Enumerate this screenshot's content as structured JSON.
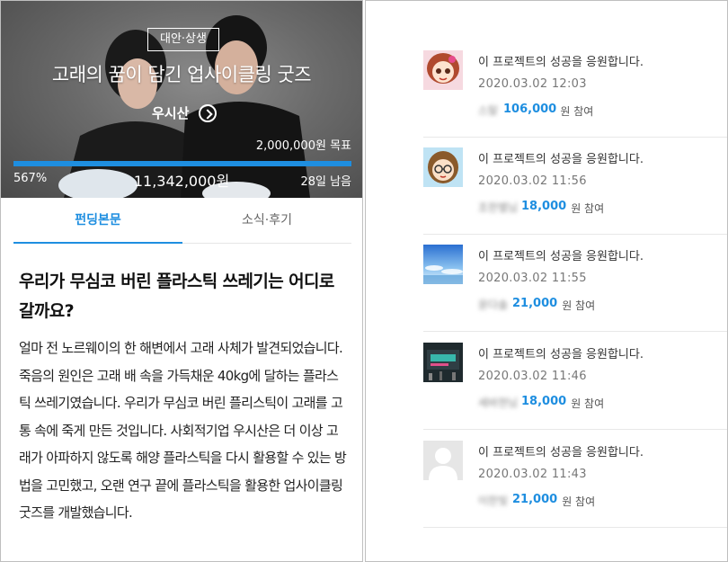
{
  "hero": {
    "category": "대안·상생",
    "title": "고래의 꿈이 담긴 업사이클링 굿즈",
    "maker": "우시산",
    "goal": "2,000,000원 목표",
    "percent": "567%",
    "amount": "11,342,000원",
    "days_left": "28일 남음",
    "progress_fraction": 1.0
  },
  "tabs": [
    {
      "label": "펀딩본문"
    },
    {
      "label": "소식·후기"
    }
  ],
  "article": {
    "heading": "우리가 무심코 버린 플라스틱 쓰레기는 어디로 갈까요?",
    "body": "얼마 전 노르웨이의 한 해변에서 고래 사체가 발견되었습니다. 죽음의 원인은 고래 배 속을 가득채운 40kg에 달하는 플라스틱 쓰레기였습니다. 우리가 무심코 버린 플리스틱이 고래를 고통 속에 죽게 만든 것입니다. 사회적기업 우시산은 더 이상 고래가 아파하지 않도록 해양 플라스틱을 다시 활용할 수 있는 방법을 고민했고, 오랜 연구 끝에 플라스틱을 활용한 업사이클링 굿즈를 개발했습니다."
  },
  "supporters": [
    {
      "message": "이 프로젝트의 성공을 응원합니다.",
      "time": "2020.03.02 12:03",
      "nickname": "스탈",
      "amount": "106,000",
      "suffix": "원 참여",
      "avatar": "girl-cartoon-icon"
    },
    {
      "message": "이 프로젝트의 성공을 응원합니다.",
      "time": "2020.03.02 11:56",
      "nickname": "조한별님",
      "amount": "18,000",
      "suffix": "원 참여",
      "avatar": "glasses-cartoon-icon"
    },
    {
      "message": "이 프로젝트의 성공을 응원합니다.",
      "time": "2020.03.02 11:55",
      "nickname": "윤다솔",
      "amount": "21,000",
      "suffix": "원 참여",
      "avatar": "sky-photo-icon"
    },
    {
      "message": "이 프로젝트의 성공을 응원합니다.",
      "time": "2020.03.02 11:46",
      "nickname": "세바현님",
      "amount": "18,000",
      "suffix": "원 참여",
      "avatar": "neon-sign-photo-icon"
    },
    {
      "message": "이 프로젝트의 성공을 응원합니다.",
      "time": "2020.03.02 11:43",
      "nickname": "이한빛",
      "amount": "21,000",
      "suffix": "원 참여",
      "avatar": "default-user-icon"
    }
  ],
  "colors": {
    "accent": "#1e8ee0",
    "border": "#bfbfbf",
    "divider": "#e8e8e8"
  }
}
